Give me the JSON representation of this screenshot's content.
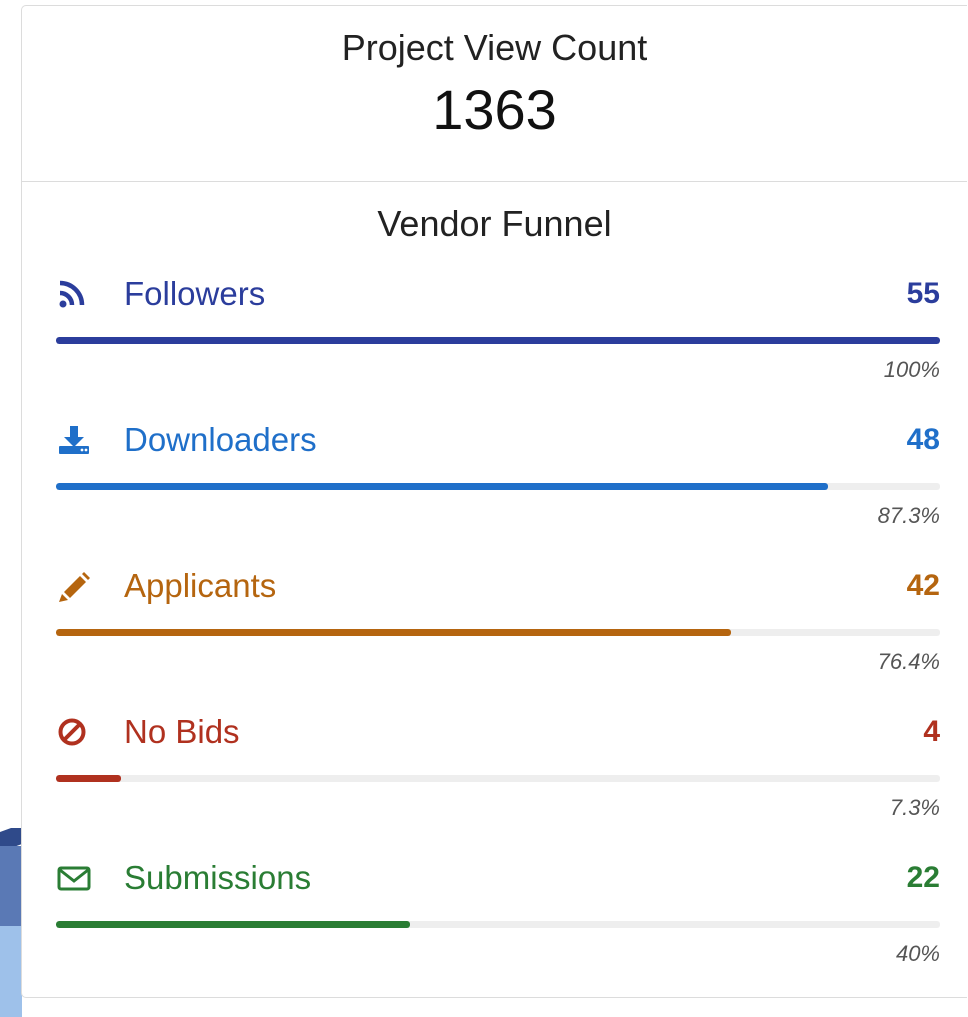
{
  "header": {
    "label": "Project View Count",
    "count": "1363"
  },
  "funnel": {
    "title": "Vendor Funnel",
    "rows": [
      {
        "icon": "rss-icon",
        "label": "Followers",
        "value": "55",
        "percent_label": "100%",
        "percent": 100,
        "color": "#2b3d9c"
      },
      {
        "icon": "download-icon",
        "label": "Downloaders",
        "value": "48",
        "percent_label": "87.3%",
        "percent": 87.3,
        "color": "#1f6fc9"
      },
      {
        "icon": "pencil-icon",
        "label": "Applicants",
        "value": "42",
        "percent_label": "76.4%",
        "percent": 76.4,
        "color": "#b5650f"
      },
      {
        "icon": "ban-icon",
        "label": "No Bids",
        "value": "4",
        "percent_label": "7.3%",
        "percent": 7.3,
        "color": "#b0311f"
      },
      {
        "icon": "envelope-icon",
        "label": "Submissions",
        "value": "22",
        "percent_label": "40%",
        "percent": 40,
        "color": "#2a7d34"
      }
    ]
  }
}
